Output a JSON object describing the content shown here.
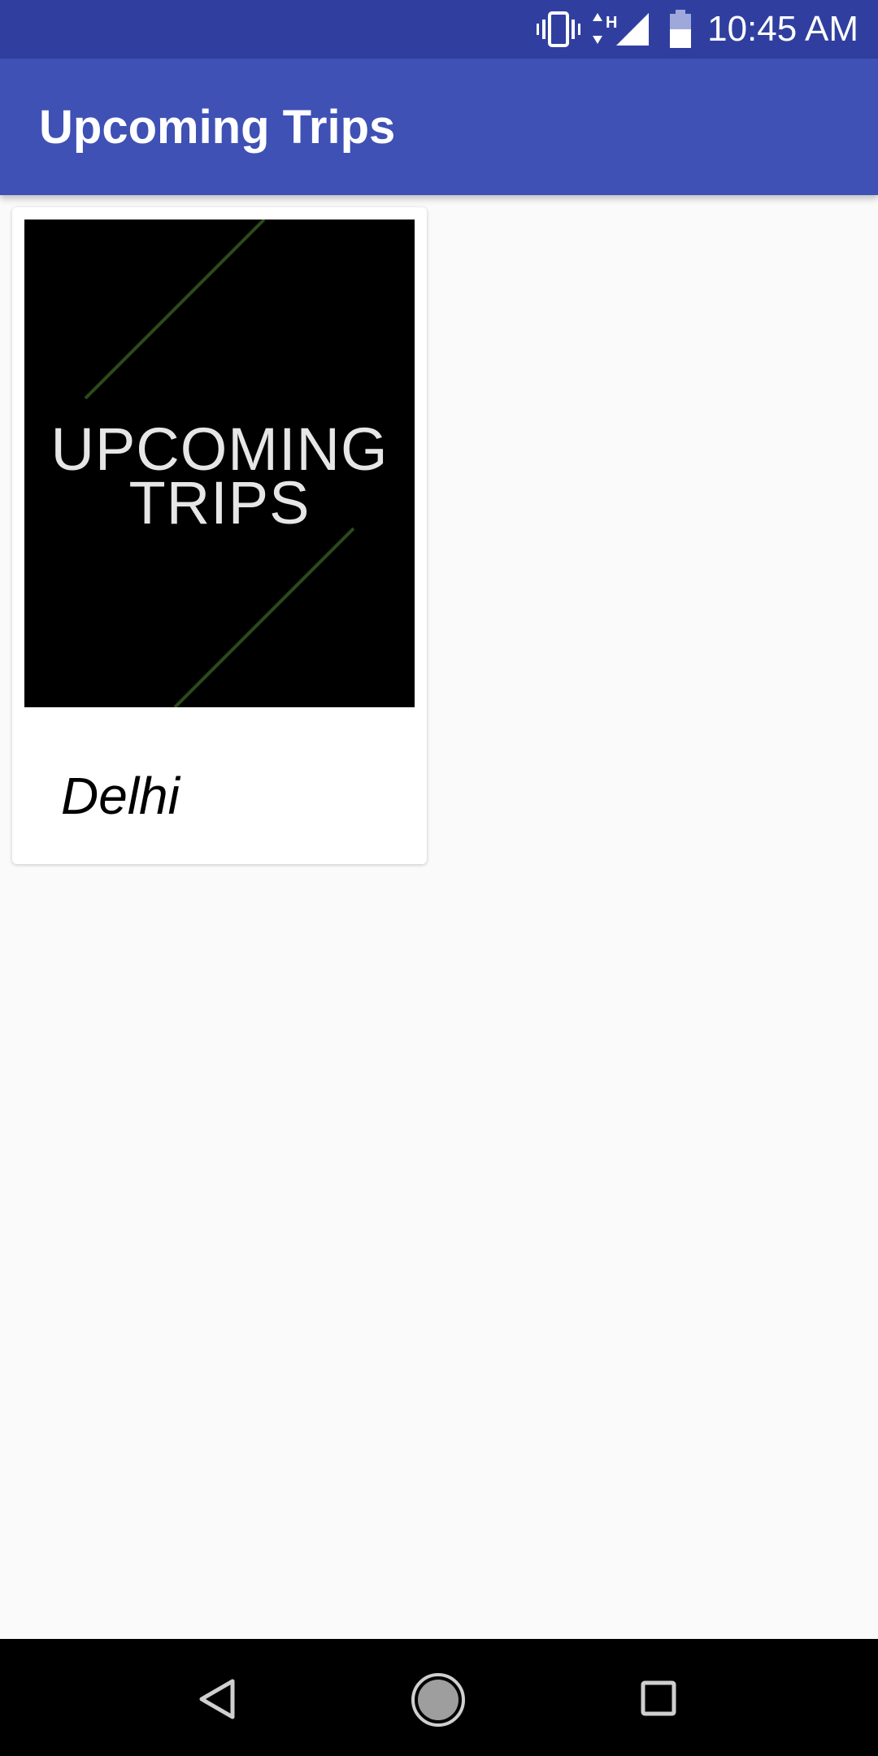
{
  "status_bar": {
    "time": "10:45 AM",
    "network_label": "H",
    "icons": [
      "vibrate-icon",
      "network-arrows-icon",
      "signal-icon",
      "battery-icon"
    ]
  },
  "app_bar": {
    "title": "Upcoming Trips"
  },
  "trips": [
    {
      "image_text_line1": "UPCOMING",
      "image_text_line2": "TRIPS",
      "name": "Delhi"
    }
  ],
  "nav_bar": {
    "icons": [
      "back-icon",
      "home-icon",
      "recents-icon"
    ]
  },
  "colors": {
    "status_bar": "#303f9f",
    "app_bar": "#3f51b5",
    "background": "#fafafa",
    "image_accent_line": "#2d4a1a"
  }
}
